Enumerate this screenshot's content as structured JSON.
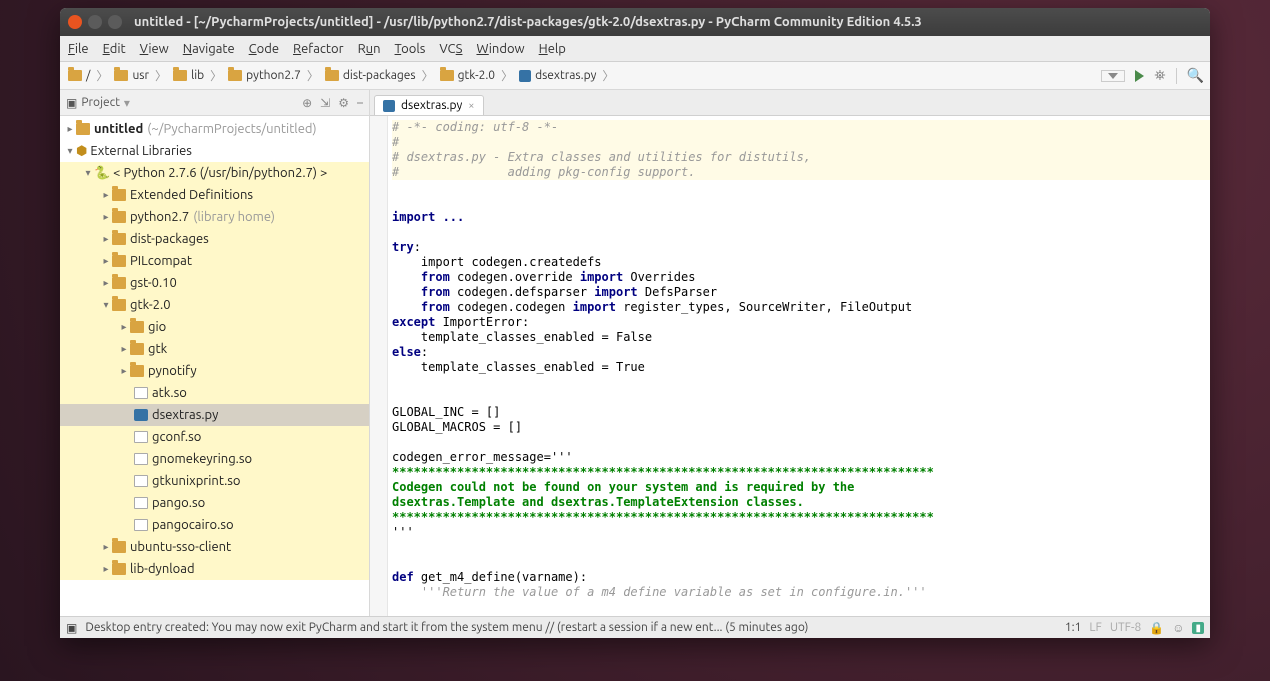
{
  "window": {
    "title": "untitled - [~/PycharmProjects/untitled] - /usr/lib/python2.7/dist-packages/gtk-2.0/dsextras.py - PyCharm Community Edition 4.5.3"
  },
  "menu": [
    "File",
    "Edit",
    "View",
    "Navigate",
    "Code",
    "Refactor",
    "Run",
    "Tools",
    "VCS",
    "Window",
    "Help"
  ],
  "breadcrumb": [
    "/",
    "usr",
    "lib",
    "python2.7",
    "dist-packages",
    "gtk-2.0",
    "dsextras.py"
  ],
  "sidebar": {
    "title": "Project",
    "nodes": {
      "project": "untitled",
      "project_path": "(~/PycharmProjects/untitled)",
      "external": "External Libraries",
      "python": "< Python 2.7.6 (/usr/bin/python2.7) >",
      "ext_def": "Extended Definitions",
      "py27": "python2.7",
      "py27_sub": "(library home)",
      "dist": "dist-packages",
      "pil": "PILcompat",
      "gst": "gst-0.10",
      "gtk": "gtk-2.0",
      "gio": "gio",
      "gtk_sub": "gtk",
      "pynotify": "pynotify",
      "atk": "atk.so",
      "dsextras": "dsextras.py",
      "gconf": "gconf.so",
      "gnomekeyring": "gnomekeyring.so",
      "gtkunixprint": "gtkunixprint.so",
      "pango": "pango.so",
      "pangocairo": "pangocairo.so",
      "ubuntu_sso": "ubuntu-sso-client",
      "lib_dynload": "lib-dynload"
    }
  },
  "tab": {
    "label": "dsextras.py"
  },
  "code": {
    "c1": "# -*- coding: utf-8 -*-",
    "c2": "#",
    "c3": "# dsextras.py - Extra classes and utilities for distutils,",
    "c4": "#               adding pkg-config support.",
    "imp": "import ...",
    "try": "try",
    "l1": "    import codegen.createdefs",
    "l2a": "    from",
    "l2b": " codegen.override ",
    "l2c": "import",
    "l2d": " Overrides",
    "l3a": "    from",
    "l3b": " codegen.defsparser ",
    "l3c": "import",
    "l3d": " DefsParser",
    "l4a": "    from",
    "l4b": " codegen.codegen ",
    "l4c": "import",
    "l4d": " register_types, SourceWriter, FileOutput",
    "exc": "except",
    "exc2": " ImportError:",
    "l5": "    template_classes_enabled = False",
    "else": "else",
    "l6": "    template_classes_enabled = True",
    "g1": "GLOBAL_INC = []",
    "g2": "GLOBAL_MACROS = []",
    "cem": "codegen_error_message='''",
    "stars": "***************************************************************************",
    "s1": "Codegen could not be found on your system and is required by the",
    "s2": "dsextras.Template and dsextras.TemplateExtension classes.",
    "end": "'''",
    "def": "def",
    "def2": " get_m4_define(varname):",
    "doc": "    '''Return the value of a m4 define variable as set in configure.in.'''"
  },
  "status": {
    "msg": "Desktop entry created: You may now exit PyCharm and start it from the system menu // (restart a session if a new ent... (5 minutes ago)",
    "pos": "1:1",
    "lf": "LF",
    "enc": "UTF-8"
  }
}
